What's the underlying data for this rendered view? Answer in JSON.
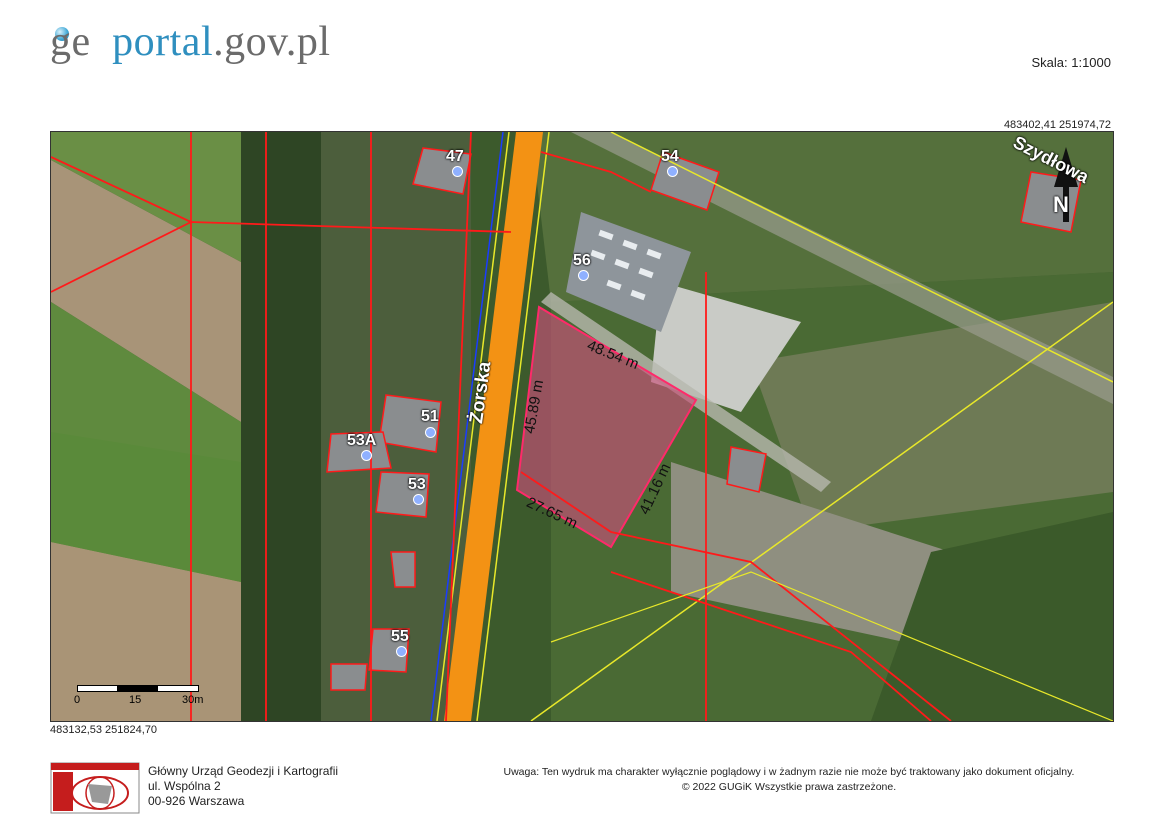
{
  "header": {
    "logo_parts": [
      "ge",
      "o",
      "portal",
      ".gov.pl"
    ],
    "scale_label": "Skala:  1:1000"
  },
  "coordinates": {
    "top_right": "483402,41   251974,72",
    "bottom_left": "483132,53   251824,70"
  },
  "map": {
    "road_label": "Żorska",
    "road_label_2": "Szydłowa",
    "north_label": "N",
    "buildings": [
      "47",
      "54",
      "56",
      "51",
      "53A",
      "53",
      "55"
    ],
    "measurements": [
      "48.54 m",
      "45.89 m",
      "41.16 m",
      "27.65 m"
    ],
    "scalebar": {
      "ticks": [
        "0",
        "15",
        "30m"
      ]
    },
    "colors": {
      "parcel_fill": "#c8507a",
      "parcel_stroke": "#ff2a6a",
      "network_red": "#ff1a1a",
      "road_orange": "#f39214",
      "line_yellow": "#e8e82a",
      "line_blue": "#1a3cff"
    }
  },
  "footer": {
    "org_lines": [
      "Główny Urząd Geodezji i Kartografii",
      "ul. Wspólna 2",
      "00-926 Warszawa"
    ],
    "notice": "Uwaga: Ten wydruk ma charakter wyłącznie poglądowy i w żadnym razie nie może być traktowany jako dokument oficjalny.",
    "copyright": "© 2022 GUGiK Wszystkie prawa zastrzeżone."
  }
}
